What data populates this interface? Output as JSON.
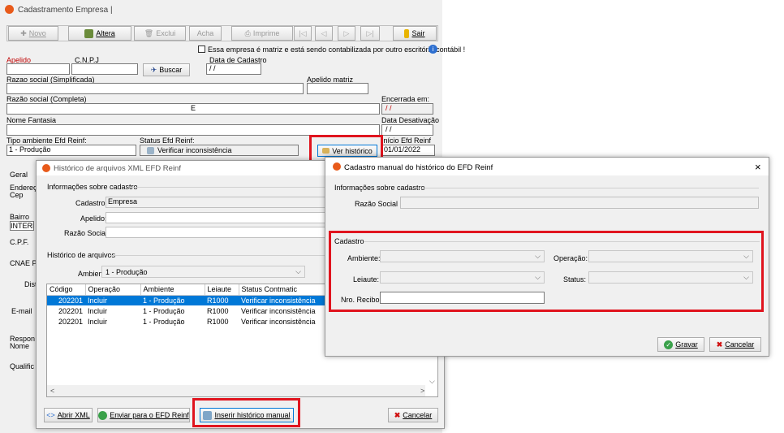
{
  "main": {
    "title": "Cadastramento Empresa |",
    "toolbar": {
      "novo": "Novo",
      "altera": "Altera",
      "exclui": "Exclui",
      "acha": "Acha",
      "imprime": "Imprime",
      "sair": "Sair"
    },
    "matriz_text": "Essa empresa é matriz e está sendo contabilizada por outro escritório contábil !",
    "labels": {
      "apelido": "Apelido",
      "cnpj": "C.N.P.J",
      "data_cadastro": "Data de Cadastro",
      "razao_simpl": "Razao social (Simplificada)",
      "apelido_matriz": "Apelido matriz",
      "razao_completa": "Razão social (Completa)",
      "encerrada": "Encerrada em:",
      "nome_fantasia": "Nome Fantasia",
      "data_desativacao": "Data Desativação",
      "tipo_ambiente": "Tipo ambiente Efd Reinf:",
      "status_reinf": "Status Efd Reinf:",
      "inicio_reinf": "Início Efd Reinf"
    },
    "values": {
      "data_cadastro": " / /",
      "razao_completa": "E",
      "encerrada": " / /",
      "desativacao": " / /",
      "tipo_ambiente": "1 - Produção",
      "status_reinf": "Verificar inconsistência",
      "inicio_reinf": "01/01/2022"
    },
    "buscar": "Buscar",
    "ver_historico": "Ver histórico",
    "side": {
      "geral": "Geral",
      "endereco": "Endereço",
      "cep": "Cep",
      "bairro": "Bairro",
      "bairro_val": "INTERL",
      "cpf": "C.P.F.",
      "cnae": "CNAE Pr",
      "dist": "Dist",
      "email": "E-mail",
      "respon": "Respon",
      "nome": "Nome",
      "qualific": "Qualific"
    }
  },
  "hist": {
    "title": "Histórico de arquivos XML EFD Reinf",
    "info_group": "Informações sobre cadastro",
    "cadastro_lbl": "Cadastro:",
    "cadastro_val": "Empresa",
    "apelido_lbl": "Apelido:",
    "razao_lbl": "Razão Social:",
    "arquivos_group": "Histórico de arquivos",
    "ambiente_lbl": "Ambiente:",
    "ambiente_val": "1 - Produção",
    "columns": [
      "Código",
      "Operação",
      "Ambiente",
      "Leiaute",
      "Status Contmatic"
    ],
    "rows": [
      [
        "202201",
        "Incluir",
        "1 - Produção",
        "R1000",
        "Verificar inconsistência"
      ],
      [
        "202201",
        "Incluir",
        "1 - Produção",
        "R1000",
        "Verificar inconsistência"
      ],
      [
        "202201",
        "Incluir",
        "1 - Produção",
        "R1000",
        "Verificar inconsistência"
      ]
    ],
    "abrir_xml": "Abrir XML",
    "enviar": "Enviar para o EFD Reinf",
    "inserir": "Inserir histórico manual",
    "cancelar": "Cancelar"
  },
  "manual": {
    "title": "Cadastro manual do histórico do EFD Reinf",
    "info_group": "Informações sobre cadastro",
    "razao_lbl": "Razão Social",
    "cadastro_group": "Cadastro",
    "ambiente_lbl": "Ambiente:",
    "operacao_lbl": "Operação:",
    "leiaute_lbl": "Leiaute:",
    "status_lbl": "Status:",
    "recibo_lbl": "Nro. Recibo:",
    "gravar": "Gravar",
    "cancelar": "Cancelar",
    "close": "×"
  },
  "colors": {
    "highlight": "#e0141e",
    "selection": "#0078d7",
    "label_red": "#c00000"
  }
}
